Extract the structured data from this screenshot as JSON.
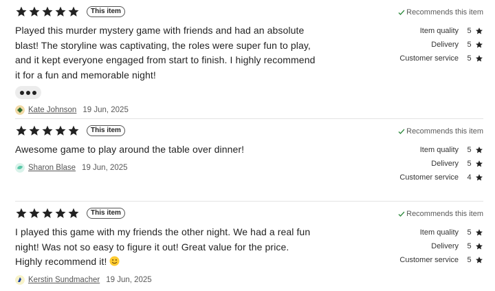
{
  "reviews": [
    {
      "rating": 5,
      "badge": "This item",
      "text": "Played this murder mystery game with friends and had an absolute blast! The storyline was captivating, the roles were super fun to play, and it kept everyone engaged from start to finish. I highly recommend it for a fun and memorable night!",
      "has_more": true,
      "author": "Kate Johnson",
      "date": "19 Jun, 2025",
      "avatar_color": "#2e6b2e",
      "recommend": "Recommends this item",
      "metrics": [
        {
          "label": "Item quality",
          "value": "5"
        },
        {
          "label": "Delivery",
          "value": "5"
        },
        {
          "label": "Customer service",
          "value": "5"
        }
      ]
    },
    {
      "rating": 5,
      "badge": "This item",
      "text": "Awesome game to play around the table over dinner!",
      "has_more": false,
      "author": "Sharon Blase",
      "date": "19 Jun, 2025",
      "avatar_color": "#5ac8a8",
      "recommend": "Recommends this item",
      "metrics": [
        {
          "label": "Item quality",
          "value": "5"
        },
        {
          "label": "Delivery",
          "value": "5"
        },
        {
          "label": "Customer service",
          "value": "4"
        }
      ]
    },
    {
      "rating": 5,
      "badge": "This item",
      "text": "I played this game with my friends the other night. We had a real fun night! Was not so easy to figure it out! Great value for the price. Highly recommend it!",
      "emoji": "slightly-smiling-face-icon",
      "has_more": false,
      "author": "Kerstin Sundmacher",
      "date": "19 Jun, 2025",
      "avatar_color": "#1a3fa0",
      "recommend": "Recommends this item",
      "metrics": [
        {
          "label": "Item quality",
          "value": "5"
        },
        {
          "label": "Delivery",
          "value": "5"
        },
        {
          "label": "Customer service",
          "value": "5"
        }
      ]
    }
  ],
  "colors": {
    "star": "#222222",
    "check": "#2f8a3e",
    "divider": "#e3e3e3"
  },
  "icons": {
    "star": "star-icon",
    "check": "checkmark-icon",
    "more": "more-dots-icon"
  }
}
